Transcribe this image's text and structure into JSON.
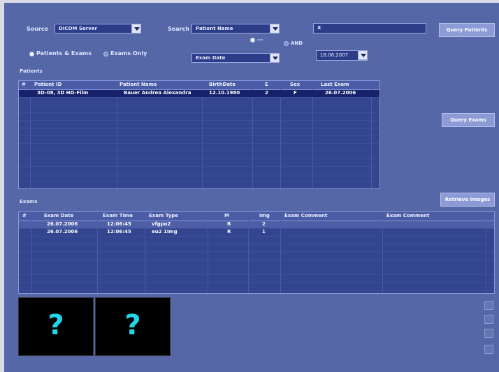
{
  "source": {
    "label": "Source",
    "value": "DICOM Server"
  },
  "search": {
    "label": "Search",
    "field": "Patient Name",
    "value": "X",
    "date_field": "Exam Date",
    "date_value": "18.06.2007"
  },
  "logic": {
    "option_dash": "---",
    "option_and": "AND"
  },
  "scope": {
    "patients_and_exams": "Patients & Exams",
    "exams_only": "Exams Only"
  },
  "buttons": {
    "query_patients": "Query Patients",
    "query_exams": "Query Exams",
    "retrieve_images": "Retrieve Images"
  },
  "patients": {
    "title": "Patients",
    "columns": [
      "#",
      "Patient ID",
      "Patient Name",
      "BirthDate",
      "E",
      "Sex",
      "Last Exam"
    ],
    "rows": [
      {
        "num": "",
        "id": "3D-08, 3D HD-Film",
        "name": "Bauer Andrea Alexandra",
        "birth": "12.10.1980",
        "e": "2",
        "sex": "F",
        "last": "26.07.2006"
      }
    ]
  },
  "exams": {
    "title": "Exams",
    "columns": [
      "#",
      "Exam Date",
      "Exam Time",
      "Exam Type",
      "M",
      "Img",
      "Exam Comment",
      "Exam Comment"
    ],
    "rows": [
      {
        "num": "",
        "date": "26.07.2006",
        "time": "12:06:45",
        "type": "vfgpo2",
        "m": "R",
        "img": "2",
        "c1": "",
        "c2": ""
      },
      {
        "num": "",
        "date": "26.07.2006",
        "time": "12:06:45",
        "type": "eu2 1img",
        "m": "R",
        "img": "1",
        "c1": "",
        "c2": ""
      }
    ]
  },
  "thumbnails": [
    {
      "glyph": "?"
    },
    {
      "glyph": "?"
    }
  ],
  "colors": {
    "background": "#5667a8",
    "grid": "#33458e",
    "selected_row": "#16236a",
    "thumb_glyph": "#22d6ea"
  }
}
